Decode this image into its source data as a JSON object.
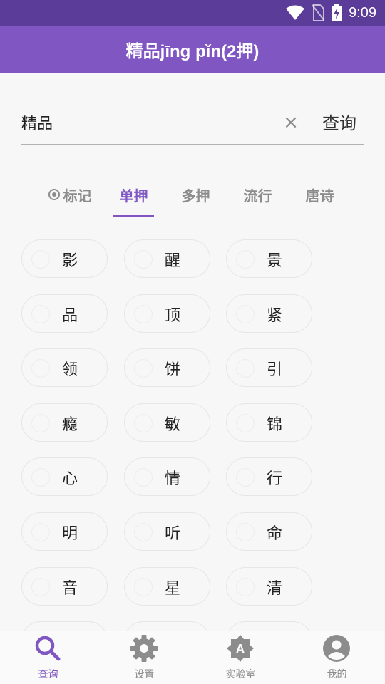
{
  "status_bar": {
    "time": "9:09"
  },
  "app_bar": {
    "title": "精品jīng pǐn(2押)"
  },
  "search": {
    "value": "精品",
    "clear_label": "×",
    "query_label": "查询"
  },
  "tabs": [
    {
      "label": "标记"
    },
    {
      "label": "单押"
    },
    {
      "label": "多押"
    },
    {
      "label": "流行"
    },
    {
      "label": "唐诗"
    }
  ],
  "active_tab": "单押",
  "results": [
    "影",
    "醒",
    "景",
    "品",
    "顶",
    "紧",
    "领",
    "饼",
    "引",
    "瘾",
    "敏",
    "锦",
    "心",
    "情",
    "行",
    "明",
    "听",
    "命",
    "音",
    "星",
    "清"
  ],
  "bottom_nav": [
    {
      "label": "查询"
    },
    {
      "label": "设置"
    },
    {
      "label": "实验室"
    },
    {
      "label": "我的"
    }
  ],
  "colors": {
    "accent": "#7f56c2",
    "status_bar": "#5b3d99",
    "inactive": "#8c8c8c"
  }
}
